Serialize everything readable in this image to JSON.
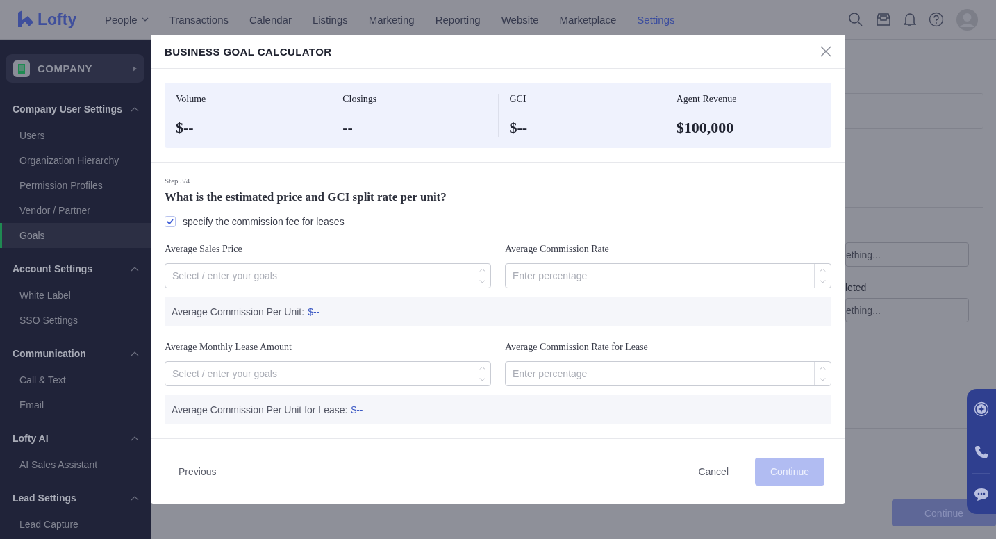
{
  "topbar": {
    "brand": "Lofty",
    "nav": [
      {
        "label": "People",
        "dropdown": true,
        "selected": false
      },
      {
        "label": "Transactions",
        "dropdown": false,
        "selected": false
      },
      {
        "label": "Calendar",
        "dropdown": false,
        "selected": false
      },
      {
        "label": "Listings",
        "dropdown": false,
        "selected": false
      },
      {
        "label": "Marketing",
        "dropdown": false,
        "selected": false
      },
      {
        "label": "Reporting",
        "dropdown": false,
        "selected": false
      },
      {
        "label": "Website",
        "dropdown": false,
        "selected": false
      },
      {
        "label": "Marketplace",
        "dropdown": false,
        "selected": false
      },
      {
        "label": "Settings",
        "dropdown": false,
        "selected": true
      }
    ]
  },
  "sidebar": {
    "company": "COMPANY",
    "groups": [
      {
        "title": "Company User Settings",
        "expanded": true,
        "items": [
          {
            "label": "Users",
            "selected": false
          },
          {
            "label": "Organization Hierarchy",
            "selected": false
          },
          {
            "label": "Permission Profiles",
            "selected": false
          },
          {
            "label": "Vendor / Partner",
            "selected": false
          },
          {
            "label": "Goals",
            "selected": true
          }
        ]
      },
      {
        "title": "Account Settings",
        "expanded": true,
        "items": [
          {
            "label": "White Label",
            "selected": false
          },
          {
            "label": "SSO Settings",
            "selected": false
          }
        ]
      },
      {
        "title": "Communication",
        "expanded": true,
        "items": [
          {
            "label": "Call & Text",
            "selected": false
          },
          {
            "label": "Email",
            "selected": false
          }
        ]
      },
      {
        "title": "Lofty AI",
        "expanded": true,
        "items": [
          {
            "label": "AI Sales Assistant",
            "selected": false
          }
        ]
      },
      {
        "title": "Lead Settings",
        "expanded": true,
        "items": [
          {
            "label": "Lead Capture",
            "selected": false
          }
        ]
      }
    ]
  },
  "background": {
    "fields": [
      {
        "placeholder": "ething..."
      },
      {
        "label": "leted",
        "placeholder": "ething..."
      }
    ],
    "button": "Continue"
  },
  "modal": {
    "title": "BUSINESS GOAL CALCULATOR",
    "stats": [
      {
        "label": "Volume",
        "value": "$--"
      },
      {
        "label": "Closings",
        "value": "--"
      },
      {
        "label": "GCI",
        "value": "$--"
      },
      {
        "label": "Agent Revenue",
        "value": "$100,000"
      }
    ],
    "step": "Step 3/4",
    "question": "What is the estimated price and GCI split rate per unit?",
    "lease_option": {
      "label": "specify the commission fee for leases",
      "checked": true
    },
    "sections": [
      {
        "fields": [
          {
            "label": "Average Sales Price",
            "placeholder": "Select / enter your goals"
          },
          {
            "label": "Average Commission Rate",
            "placeholder": "Enter percentage"
          }
        ],
        "summary": {
          "label": "Average Commission Per Unit:",
          "value": "$--"
        }
      },
      {
        "fields": [
          {
            "label": "Average Monthly Lease Amount",
            "placeholder": "Select / enter your goals"
          },
          {
            "label": "Average Commission Rate for Lease",
            "placeholder": "Enter percentage"
          }
        ],
        "summary": {
          "label": "Average Commission Per Unit for Lease:",
          "value": "$--"
        }
      }
    ],
    "previous": "Previous",
    "cancel": "Cancel",
    "continue": {
      "label": "Continue",
      "disabled": true
    }
  }
}
